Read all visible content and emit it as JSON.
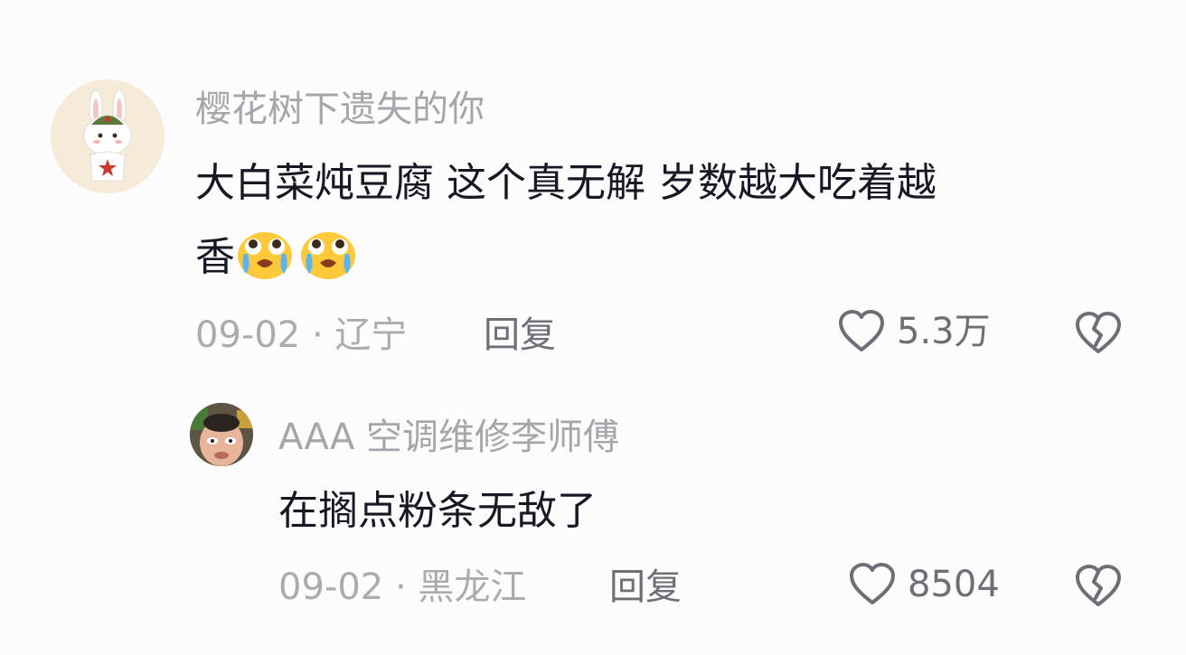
{
  "comment": {
    "username": "樱花树下遗失的你",
    "text_line1": "大白菜炖豆腐  这个真无解  岁数越大吃着越",
    "text_line2": "香",
    "emojis": [
      "crying-emoji",
      "crying-emoji"
    ],
    "date": "09-02",
    "separator": " · ",
    "location": "辽宁",
    "reply_label": "回复",
    "like_count": "5.3万"
  },
  "reply": {
    "username": "AAA 空调维修李师傅",
    "text": "在搁点粉条无敌了",
    "date": "09-02",
    "separator": " · ",
    "location": "黑龙江",
    "reply_label": "回复",
    "like_count": "8504"
  },
  "colors": {
    "text_primary": "#161823",
    "text_secondary": "#a4a6ab",
    "action": "#6d6f76",
    "background": "#fcfcfc"
  }
}
